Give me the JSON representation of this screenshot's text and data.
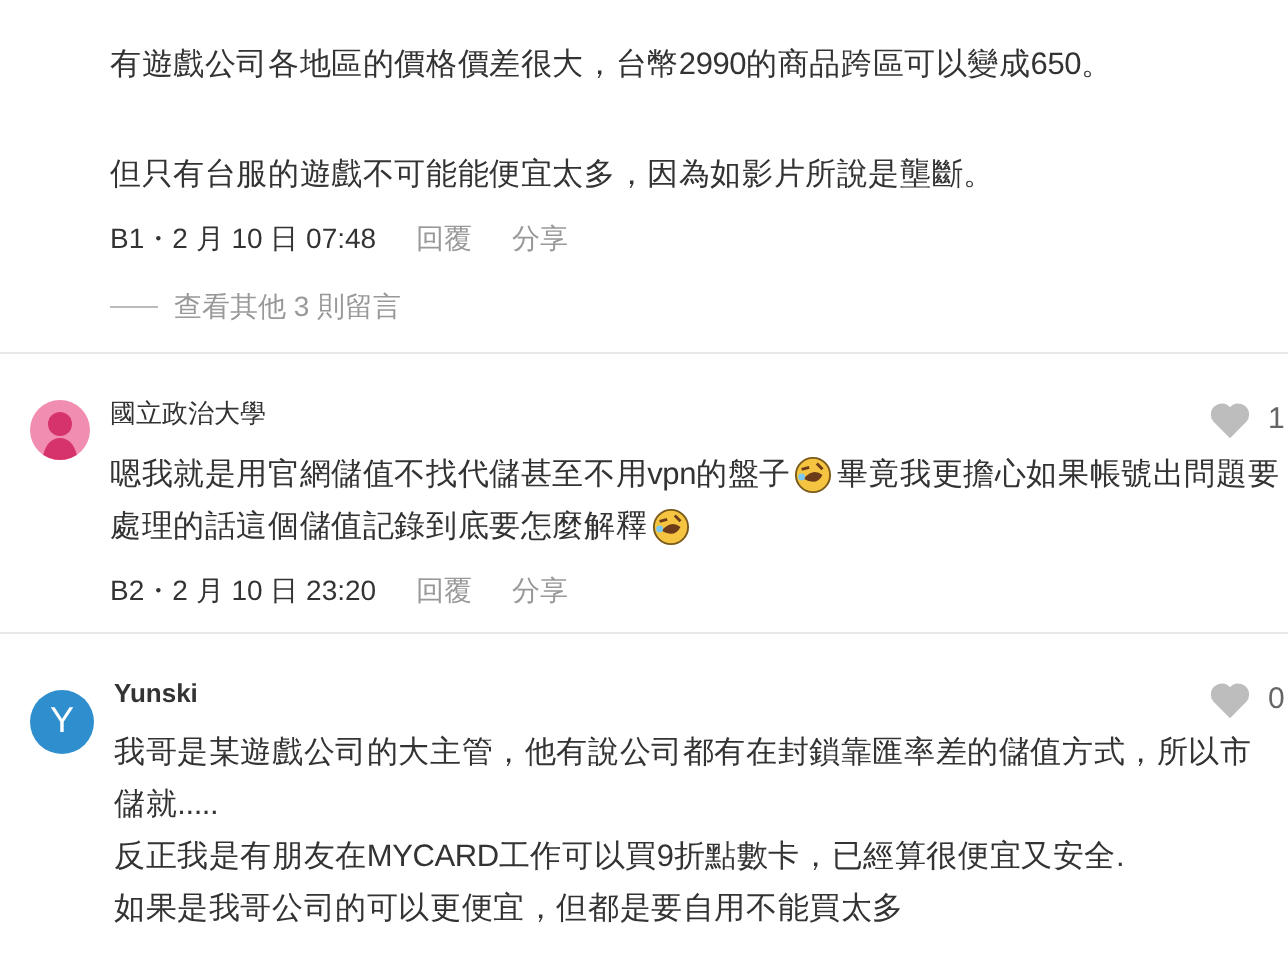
{
  "top_comment": {
    "paragraphs": [
      [
        {
          "kind": "text",
          "text": "有遊戲公司各地區的價格價差很大，台幣2990的商品跨區可以變成650。"
        }
      ],
      [
        {
          "kind": "text",
          "text": "但只有台服的遊戲不可能能便宜太多，因為如影片所說是壟斷。"
        }
      ]
    ],
    "meta": "B1・2 月 10 日 07:48",
    "actions": [
      "回覆",
      "分享"
    ],
    "more_replies": "查看其他 3 則留言"
  },
  "comments": [
    {
      "avatar": {
        "kind": "silhouette",
        "color": "#f28db2"
      },
      "author": "國立政治大學",
      "author_bold": false,
      "likes": "1",
      "lines": [
        [
          {
            "kind": "text",
            "text": "嗯我就是用官網儲值不找代儲甚至不用vpn的盤子"
          },
          {
            "kind": "emoji"
          },
          {
            "kind": "text",
            "text": "畢竟我更擔心如果帳號出問題要"
          }
        ],
        [
          {
            "kind": "text",
            "text": "處理的話這個儲值記錄到底要怎麼解釋"
          },
          {
            "kind": "emoji"
          }
        ]
      ],
      "meta": "B2・2 月 10 日 23:20",
      "actions": [
        "回覆",
        "分享"
      ]
    },
    {
      "avatar": {
        "kind": "letter",
        "letter": "Y",
        "color": "#2f8fce"
      },
      "author": "Yunski",
      "author_bold": true,
      "likes": "0",
      "lines": [
        [
          {
            "kind": "text",
            "text": "我哥是某遊戲公司的大主管，他有說公司都有在封鎖靠匯率差的儲值方式，所以市"
          }
        ],
        [
          {
            "kind": "text",
            "text": "儲就....."
          }
        ],
        [
          {
            "kind": "text",
            "text": "反正我是有朋友在MYCARD工作可以買9折點數卡，已經算很便宜又安全."
          }
        ],
        [
          {
            "kind": "text",
            "text": "如果是我哥公司的可以更便宜，但都是要自用不能買太多"
          }
        ]
      ]
    }
  ]
}
